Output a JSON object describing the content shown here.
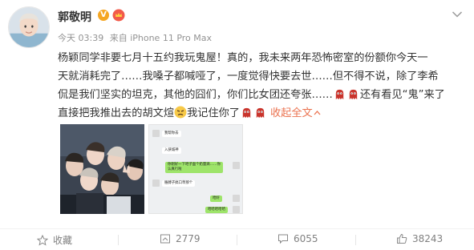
{
  "user": {
    "name": "郭敬明",
    "verified_badge": "V"
  },
  "meta": {
    "time": "今天 03:39",
    "source": "来自 iPhone 11 Pro Max"
  },
  "content": {
    "line1": "杨颖同学非要七月十五约我玩鬼屋！真的，我未来两年恐怖密室的份额你今天一",
    "line2": "天就消耗完了……我嗓子都喊哑了，一度觉得快要去世……但不得不说，除了李希",
    "line3a": "侃是我们坚实的坦克，其他的囧们，你们比女团还夸张……",
    "line3b": "还有看见“鬼”来了",
    "line4a": "直接把我推出去的胡文煊",
    "line4b": "我记住你了",
    "collapse_label": "收起全文"
  },
  "chat": {
    "b1": "我帮你去",
    "b2": "入侠城神",
    "b3": "你刚好一下吧子面个奶量滴……你认真行啦",
    "b4": "胳膊子搞口草那个",
    "b5": "哈好",
    "b6": "哈哈哈哈哈"
  },
  "actions": {
    "favorite_label": "收藏",
    "repost_count": "2779",
    "comment_count": "6055",
    "like_count": "38243"
  },
  "colors": {
    "accent": "#eb7350",
    "badge": "#f5a623",
    "meta": "#939393"
  }
}
